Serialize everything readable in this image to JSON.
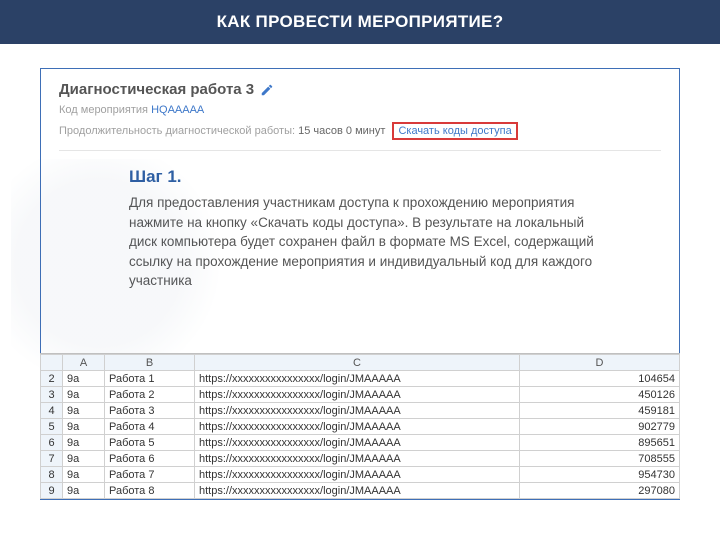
{
  "header": {
    "title": "КАК ПРОВЕСТИ МЕРОПРИЯТИЕ?"
  },
  "diag": {
    "title": "Диагностическая работа 3",
    "code_label": "Код мероприятия",
    "code_value": "HQAAAAA",
    "duration_label": "Продолжительность диагностической работы:",
    "duration_value": "15 часов 0 минут",
    "download_link": "Скачать коды доступа"
  },
  "step": {
    "title": "Шаг 1.",
    "body": "Для предоставления участникам доступа к прохождению мероприятия нажмите на кнопку «Скачать коды доступа». В результате на локальный диск компьютера будет сохранен файл в формате MS Excel, содержащий ссылку на прохождение мероприятия и индивидуальный код для каждого участника"
  },
  "chart_data": {
    "type": "table",
    "title": "Excel preview",
    "columns": [
      "A",
      "B",
      "C",
      "D"
    ],
    "row_numbers": [
      2,
      3,
      4,
      5,
      6,
      7,
      8,
      9
    ],
    "rows": [
      {
        "a": "9a",
        "b": "Работа 1",
        "c": "https://xxxxxxxxxxxxxxxx/login/JMAAAAA",
        "d": "104654"
      },
      {
        "a": "9a",
        "b": "Работа 2",
        "c": "https://xxxxxxxxxxxxxxxx/login/JMAAAAA",
        "d": "450126"
      },
      {
        "a": "9a",
        "b": "Работа 3",
        "c": "https://xxxxxxxxxxxxxxxx/login/JMAAAAA",
        "d": "459181"
      },
      {
        "a": "9a",
        "b": "Работа 4",
        "c": "https://xxxxxxxxxxxxxxxx/login/JMAAAAA",
        "d": "902779"
      },
      {
        "a": "9a",
        "b": "Работа 5",
        "c": "https://xxxxxxxxxxxxxxxx/login/JMAAAAA",
        "d": "895651"
      },
      {
        "a": "9a",
        "b": "Работа 6",
        "c": "https://xxxxxxxxxxxxxxxx/login/JMAAAAA",
        "d": "708555"
      },
      {
        "a": "9a",
        "b": "Работа 7",
        "c": "https://xxxxxxxxxxxxxxxx/login/JMAAAAA",
        "d": "954730"
      },
      {
        "a": "9a",
        "b": "Работа 8",
        "c": "https://xxxxxxxxxxxxxxxx/login/JMAAAAA",
        "d": "297080"
      }
    ]
  }
}
